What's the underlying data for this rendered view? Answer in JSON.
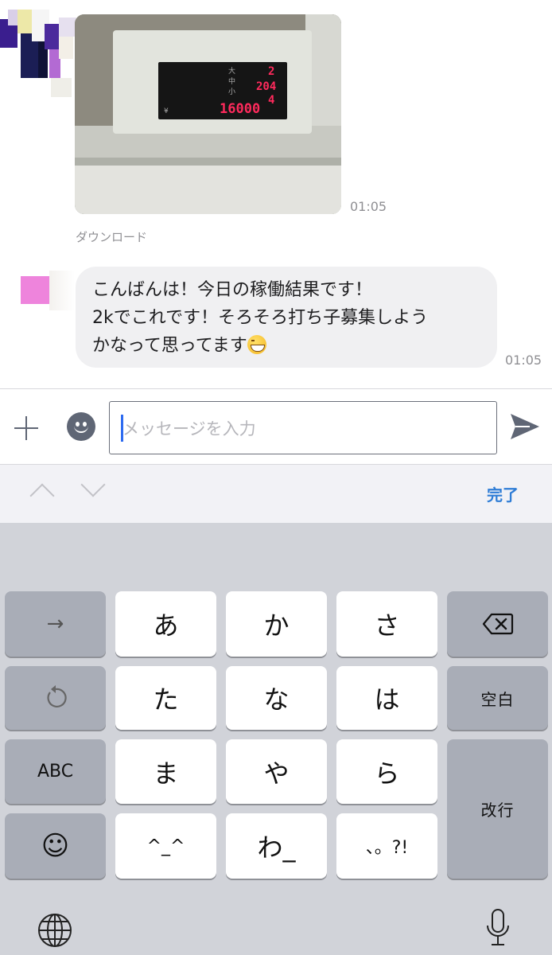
{
  "chat": {
    "photo_time": "01:05",
    "download_label": "ダウンロード",
    "message_lines": [
      "こんばんは！今日の稼働結果です！",
      "2kでこれです！そろそろ打ち子募集しよう",
      "かなって思ってます"
    ],
    "message_emoji": "grinning-squinting-face",
    "message_time": "01:05",
    "photo_counter_digits": [
      "2",
      "204",
      "4",
      "16000"
    ],
    "photo_counter_labels": [
      "大",
      "中",
      "小",
      "¥"
    ]
  },
  "input_bar": {
    "placeholder": "メッセージを入力",
    "plus_icon": "plus-icon",
    "emoji_icon": "smiley-icon",
    "send_icon": "send-icon"
  },
  "accessory": {
    "done_label": "完了"
  },
  "keyboard": {
    "rows": [
      [
        "→",
        "あ",
        "か",
        "さ",
        "⌫"
      ],
      [
        "↺",
        "た",
        "な",
        "は",
        "空白"
      ],
      [
        "ABC",
        "ま",
        "や",
        "ら",
        "改行"
      ],
      [
        "☺",
        "^_^",
        "わ_",
        "、。?!"
      ]
    ],
    "bottom_icons": [
      "globe-icon",
      "microphone-icon"
    ]
  },
  "colors": {
    "accent_blue": "#2f7dd6",
    "caret": "#2e6bf0",
    "bubble": "#f0f0f2",
    "keyboard_bg": "#d1d3d9",
    "key_dark": "#a9adb7",
    "counter_red": "#ff2a5c"
  }
}
